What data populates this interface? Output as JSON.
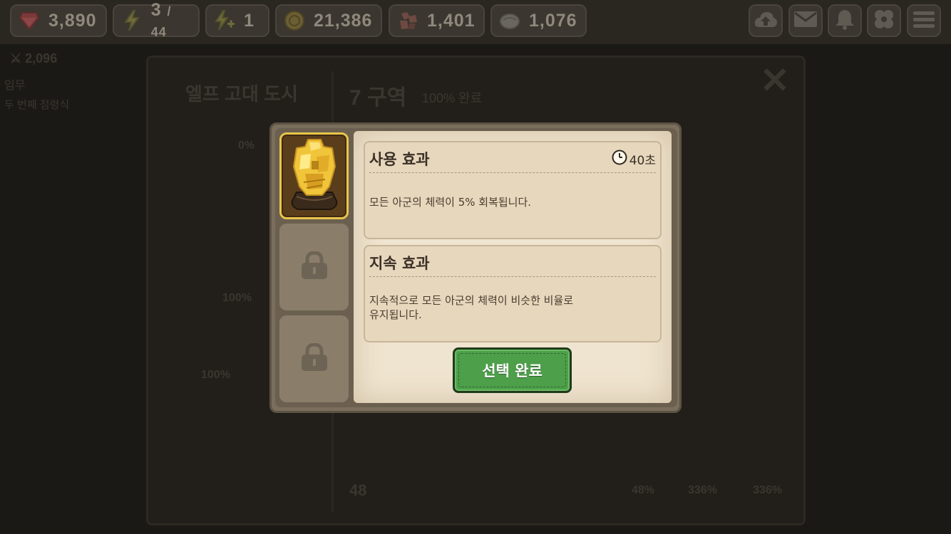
{
  "resources": {
    "gems": "3,890",
    "energy": "3",
    "energy_max": "/ 44",
    "boost": "1",
    "gold": "21,386",
    "ore": "1,401",
    "stone": "1,076"
  },
  "background": {
    "power": "2,096",
    "mission_label": "임무",
    "quest_title": "두 번째 점령식",
    "region_name": "엘프 고대 도시",
    "zone_title": "7 구역",
    "zone_progress": "100% 완료",
    "percent_a": "0%",
    "percent_b": "100%",
    "percent_c": "100%",
    "bottom_count": "48",
    "stat_a": "48%",
    "stat_b": "336%",
    "stat_c": "336%"
  },
  "dialog": {
    "use_effect": {
      "title": "사용 효과",
      "duration": "40초",
      "description": "모든 아군의 체력이 5% 회복됩니다."
    },
    "lasting_effect": {
      "title": "지속 효과",
      "description_line1": "지속적으로 모든 아군의 체력이 비슷한 비율로",
      "description_line2": "유지됩니다."
    },
    "confirm_label": "선택 완료"
  },
  "colors": {
    "confirm_button": "#4d9f4a",
    "slot_border_active": "#e9c44a",
    "parchment": "#efe4cf"
  }
}
